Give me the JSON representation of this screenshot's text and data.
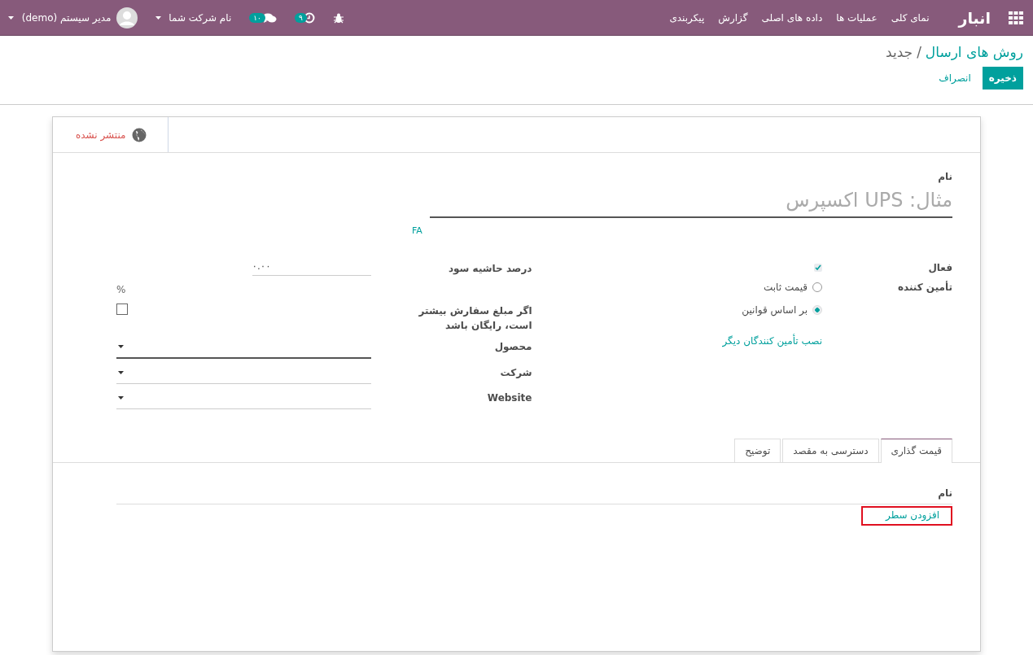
{
  "navbar": {
    "brand": "انبار",
    "menu": [
      "نمای کلی",
      "عملیات ها",
      "داده های اصلی",
      "گزارش",
      "پیکربندی"
    ],
    "activity_badge": "۹",
    "messages_badge": "۱۰",
    "company": "نام شرکت شما",
    "user": "مدیر سیستم (demo)"
  },
  "breadcrumb": {
    "parent": "روش های ارسال",
    "separator": "/",
    "current": "جدید"
  },
  "buttons": {
    "save": "ذخیره",
    "discard": "انصراف"
  },
  "button_box": {
    "label": "منتشر نشده",
    "published": false
  },
  "name_field": {
    "label": "نام",
    "placeholder": "مثال: UPS اکسپرس",
    "translate": "FA"
  },
  "right_group": {
    "active": {
      "label": "فعال",
      "checked": true
    },
    "provider": {
      "label": "تأمین کننده",
      "options": [
        {
          "label": "قیمت ثابت",
          "selected": false
        },
        {
          "label": "بر اساس قوانین",
          "selected": true
        }
      ]
    },
    "install_link": "نصب تأمین کنندگان دیگر"
  },
  "left_group": {
    "margin": {
      "label": "درصد حاشیه سود",
      "value": "۰.۰۰",
      "unit": "%"
    },
    "free_over": {
      "label": "اگر مبلغ سفارش بیشتر است، رایگان باشد",
      "checked": false
    },
    "selects": [
      {
        "label": "محصول",
        "focused": true
      },
      {
        "label": "شرکت",
        "focused": false
      },
      {
        "label": "Website",
        "focused": false
      }
    ]
  },
  "tabs": [
    {
      "label": "قیمت گذاری",
      "selected": true
    },
    {
      "label": "دسترسی به مقصد",
      "selected": false
    },
    {
      "label": "توضیح",
      "selected": false
    }
  ],
  "table": {
    "column": "نام",
    "add_line": "افزودن سطر"
  }
}
